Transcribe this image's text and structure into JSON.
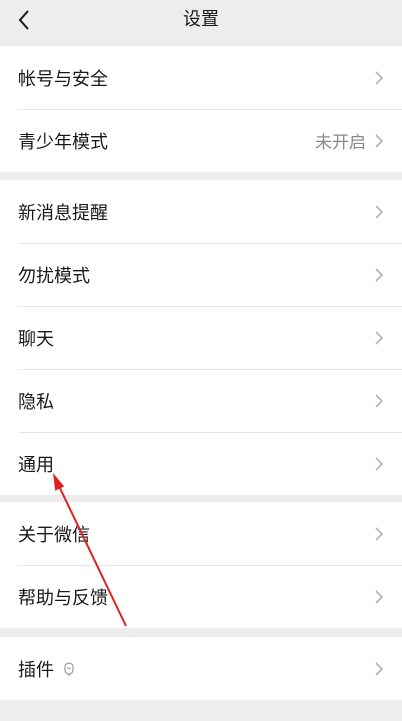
{
  "header": {
    "title": "设置"
  },
  "groups": [
    {
      "items": [
        {
          "label": "帐号与安全"
        },
        {
          "label": "青少年模式",
          "value": "未开启"
        }
      ]
    },
    {
      "items": [
        {
          "label": "新消息提醒"
        },
        {
          "label": "勿扰模式"
        },
        {
          "label": "聊天"
        },
        {
          "label": "隐私"
        },
        {
          "label": "通用"
        }
      ]
    },
    {
      "items": [
        {
          "label": "关于微信"
        },
        {
          "label": "帮助与反馈"
        }
      ]
    },
    {
      "items": [
        {
          "label": "插件",
          "icon": "plugin-icon"
        }
      ]
    }
  ],
  "colors": {
    "background": "#ededed",
    "card": "#ffffff",
    "text": "#191919",
    "secondary_text": "#8a8a8a",
    "annotation_arrow": "#e0201e"
  }
}
